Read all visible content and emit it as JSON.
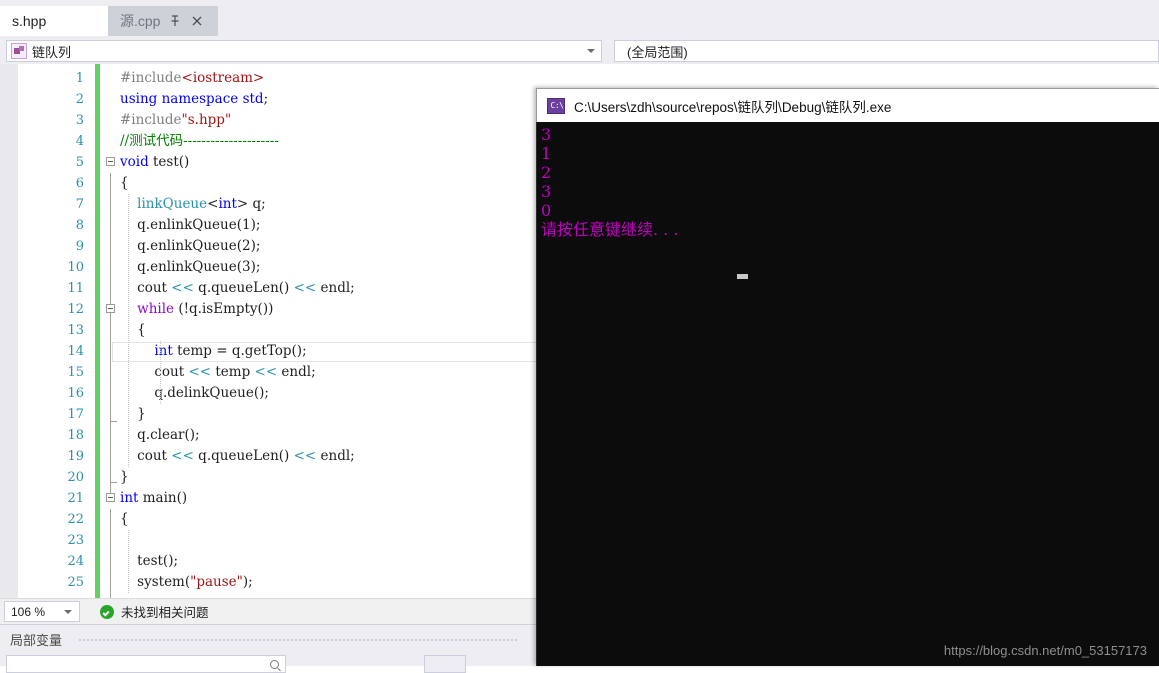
{
  "tabs": [
    {
      "label": "s.hpp",
      "active": false
    },
    {
      "label": "源.cpp",
      "active": true,
      "pin_icon": "pin-icon",
      "close_icon": "close-icon"
    }
  ],
  "navbar": {
    "scope_left": {
      "icon": "class-icon",
      "value": "链队列",
      "dropdown_icon": "chevron-down-icon"
    },
    "scope_right": {
      "value": "(全局范围)"
    }
  },
  "editor": {
    "line_numbers": [
      "1",
      "2",
      "3",
      "4",
      "5",
      "6",
      "7",
      "8",
      "9",
      "10",
      "11",
      "12",
      "13",
      "14",
      "15",
      "16",
      "17",
      "18",
      "19",
      "20",
      "21",
      "22",
      "23",
      "24",
      "25"
    ],
    "lines": [
      {
        "n": 1,
        "text": "#include<iostream>"
      },
      {
        "n": 2,
        "text": "using namespace std;"
      },
      {
        "n": 3,
        "text": "#include\"s.hpp\""
      },
      {
        "n": 4,
        "text": "//测试代码---------------------"
      },
      {
        "n": 5,
        "text": "void test()"
      },
      {
        "n": 6,
        "text": "{"
      },
      {
        "n": 7,
        "text": "    linkQueue<int> q;"
      },
      {
        "n": 8,
        "text": "    q.enlinkQueue(1);"
      },
      {
        "n": 9,
        "text": "    q.enlinkQueue(2);"
      },
      {
        "n": 10,
        "text": "    q.enlinkQueue(3);"
      },
      {
        "n": 11,
        "text": "    cout << q.queueLen() << endl;"
      },
      {
        "n": 12,
        "text": "    while (!q.isEmpty())"
      },
      {
        "n": 13,
        "text": "    {"
      },
      {
        "n": 14,
        "text": "        int temp = q.getTop();"
      },
      {
        "n": 15,
        "text": "        cout << temp << endl;"
      },
      {
        "n": 16,
        "text": "        q.delinkQueue();"
      },
      {
        "n": 17,
        "text": "    }"
      },
      {
        "n": 18,
        "text": "    q.clear();"
      },
      {
        "n": 19,
        "text": "    cout << q.queueLen() << endl;"
      },
      {
        "n": 20,
        "text": "}"
      },
      {
        "n": 21,
        "text": "int main()"
      },
      {
        "n": 22,
        "text": "{"
      },
      {
        "n": 23,
        "text": ""
      },
      {
        "n": 24,
        "text": "    test();"
      },
      {
        "n": 25,
        "text": "    system(\"pause\");"
      }
    ],
    "current_line": 11
  },
  "status_bar": {
    "zoom": "106 %",
    "zoom_dropdown_icon": "chevron-down-icon",
    "issue_icon": "check-circle-icon",
    "issue_text": "未找到相关问题"
  },
  "bottom_panel": {
    "title": "局部变量",
    "search_icon": "search-icon"
  },
  "console": {
    "icon": "console-icon",
    "title": "C:\\Users\\zdh\\source\\repos\\链队列\\Debug\\链队列.exe",
    "output": [
      "3",
      "1",
      "2",
      "3",
      "0",
      "请按任意键继续. . ."
    ]
  },
  "watermark": "https://blog.csdn.net/m0_53157173",
  "colors": {
    "keyword": "#0000ff",
    "control_keyword": "#8f08c4",
    "class_name": "#2b91af",
    "comment": "#008000",
    "string": "#a31515",
    "line_number": "#2b91af",
    "change_bar": "#62d162",
    "console_text": "#c000c0",
    "console_bg": "#0c0c0c",
    "chrome_bg": "#eeeef2"
  }
}
